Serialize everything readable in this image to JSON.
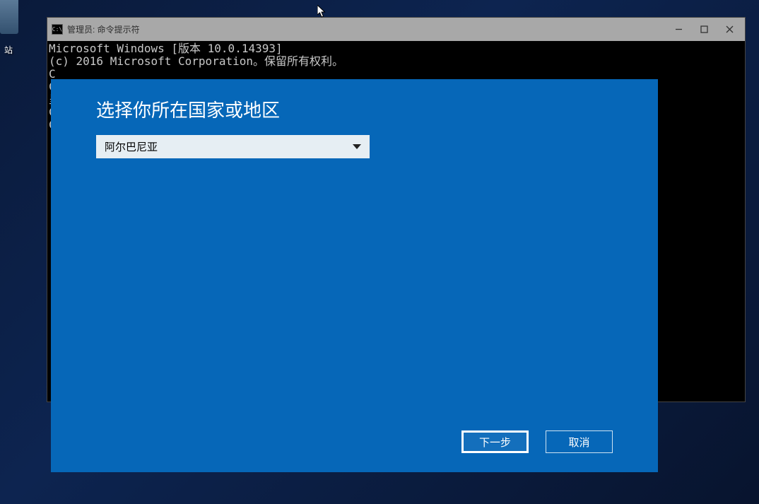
{
  "desktop": {
    "recycle_label": "站"
  },
  "cmd": {
    "title": "管理员: 命令提示符",
    "lines": [
      "Microsoft Windows [版本 10.0.14393]",
      "(c) 2016 Microsoft Corporation。保留所有权利。",
      "",
      "C",
      "",
      "C",
      "",
      "呈",
      "",
      "C",
      "",
      "C"
    ]
  },
  "dialog": {
    "title": "选择你所在国家或地区",
    "dropdown_value": "阿尔巴尼亚",
    "next_button": "下一步",
    "cancel_button": "取消"
  }
}
